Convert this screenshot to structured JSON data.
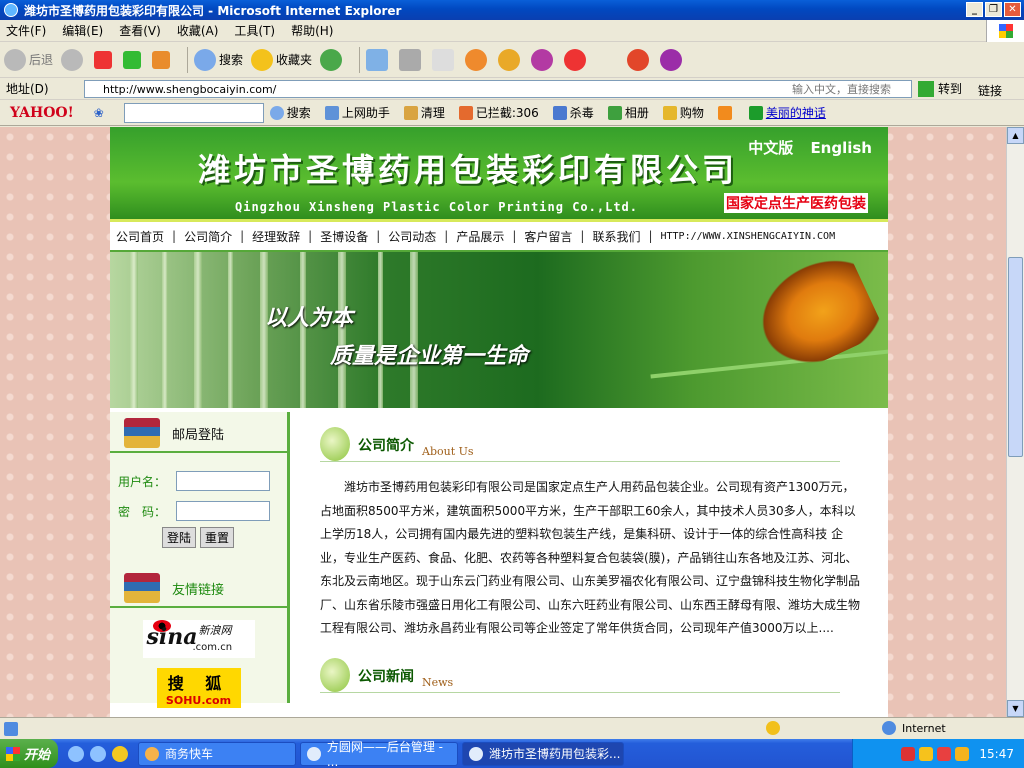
{
  "window": {
    "title": "潍坊市圣博药用包装彩印有限公司 - Microsoft Internet Explorer",
    "controls": [
      "_",
      "❐",
      "✕"
    ]
  },
  "menu": [
    "文件(F)",
    "编辑(E)",
    "查看(V)",
    "收藏(A)",
    "工具(T)",
    "帮助(H)"
  ],
  "toolbar": {
    "back": "后退",
    "search": "搜索",
    "favorites": "收藏夹"
  },
  "address": {
    "label": "地址(D)",
    "url": "http://www.shengbocaiyin.com/",
    "placeholder": "输入中文，直接搜索",
    "go": "转到",
    "links": "链接"
  },
  "yahoo_bar": {
    "logo": "YAHOO!",
    "search": "搜索",
    "helper": "上网助手",
    "clean": "清理",
    "blocked": "已拦截:306",
    "antivirus": "杀毒",
    "album": "相册",
    "shopping": "购物",
    "link": "美丽的神话"
  },
  "site": {
    "brand_cn": "潍坊市圣博药用包装彩印有限公司",
    "brand_en": "Qingzhou Xinsheng Plastic Color Printing Co.,Ltd.",
    "lang_cn": "中文版",
    "lang_en": "English",
    "slogan_tag": "国家定点生产医药包装",
    "nav": [
      "公司首页",
      "公司简介",
      "经理致辞",
      "圣博设备",
      "公司动态",
      "产品展示",
      "客户留言",
      "联系我们"
    ],
    "nav_url": "HTTP://WWW.XINSHENGCAIYIN.COM",
    "hero_line1": "以人为本",
    "hero_line2": "质量是企业第一生命",
    "login": {
      "title": "邮局登陆",
      "user_label": "用户名：",
      "pass_label": "密　码：",
      "login_btn": "登陆",
      "reset_btn": "重置"
    },
    "links_box": {
      "title": "友情链接",
      "sina_cn": "新浪网",
      "sina_logo": "sina",
      "sina_domain": ".com.cn",
      "sohu_cn": "搜 狐",
      "sohu_en": "SOHU.com"
    },
    "about": {
      "title": "公司简介",
      "title_en": "About Us",
      "text": "潍坊市圣博药用包装彩印有限公司是国家定点生产人用药品包装企业。公司现有资产1300万元，占地面积8500平方米，建筑面积5000平方米，生产干部职工60余人，其中技术人员30多人，本科以上学历18人，公司拥有国内最先进的塑料软包装生产线，是集科研、设计于一体的综合性高科技 企业，专业生产医药、食品、化肥、农药等各种塑料复合包装袋(膜)，产品销往山东各地及江苏、河北、东北及云南地区。现于山东云门药业有限公司、山东美罗福农化有限公司、辽宁盘锦科技生物化学制品厂、山东省乐陵市强盛日用化工有限公司、山东六旺药业有限公司、山东西王酵母有限、潍坊大成生物工程有限公司、潍坊永昌药业有限公司等企业签定了常年供货合同，公司现年产值3000万以上...."
    },
    "news": {
      "title": "公司新闻",
      "title_en": "News"
    }
  },
  "status": {
    "zone": "Internet"
  },
  "taskbar": {
    "start": "开始",
    "tasks": [
      "商务快车",
      "方圆网——后台管理 - ...",
      "潍坊市圣博药用包装彩..."
    ],
    "clock": "15:47"
  }
}
